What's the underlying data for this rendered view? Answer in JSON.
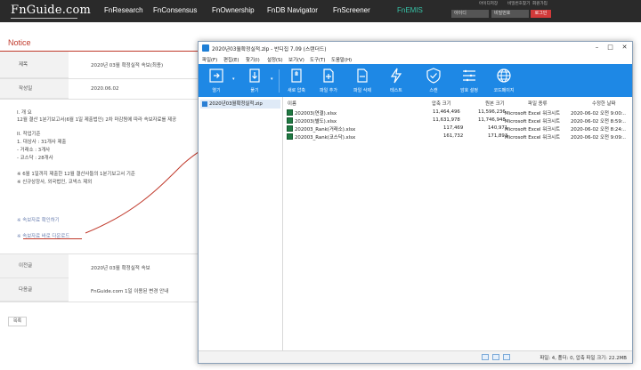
{
  "topbar": {
    "logo": "FnGuide.com",
    "nav": [
      "FnResearch",
      "FnConsensus",
      "FnOwnership",
      "FnDB Navigator",
      "FnScreener",
      "FnEMIS"
    ],
    "util_links": [
      "아이디저장",
      "비밀번호찾기",
      "회원가입"
    ],
    "id_placeholder": "아이디",
    "pw_placeholder": "비밀번호",
    "login_label": "로그인"
  },
  "notice": {
    "page_title": "Notice",
    "subject_label": "제목",
    "subject_value": "2020년 03월 확정실적 속보(최종)",
    "date_label": "작성일",
    "date_value": "2020.06.02",
    "body": [
      "I. 개 요",
      "12월 결산 1분기보고서(6월 1일 제출법인) 2차 마감됨에 따라 속보자료를 제공",
      "II. 작업기준",
      "1. 대상사 : 31개사 제출",
      "- 거래소 : 3개사",
      "- 코스닥 : 28개사",
      "※ 6월 1일까지 제출한 12월 결산사들의 1분기보고서 기준",
      "※ 신규상장사, 외국법인, 코넥스 제외"
    ],
    "link_check": "※ 속보자료 확인하기",
    "link_download": "※ 속보자료 바로 다운로드",
    "prev_label": "이전글",
    "prev_value": "2020년 03월 확정실적 속보",
    "next_label": "다음글",
    "next_value": "FnGuide.com 1일 이용된 변경 안내",
    "list_button": "목록"
  },
  "window": {
    "title": "2020년03월확정실적.zip - 반디집 7.09 (스탠더드)",
    "menu": [
      "파일(F)",
      "편집(E)",
      "찾기(I)",
      "설정(S)",
      "보기(V)",
      "도구(T)",
      "도움말(H)"
    ],
    "toolbar": [
      "열기",
      "풀기",
      "새로 압축",
      "파일 추가",
      "파일 삭제",
      "테스트",
      "스캔",
      "암호 설정",
      "코드페이지"
    ],
    "tree_root": "2020년03월확정실적.zip",
    "columns": [
      "이름",
      "압축 크기",
      "원본 크기",
      "파일 종류",
      "수정한 날짜"
    ],
    "files": [
      {
        "name": "202003(연결).xlsx",
        "packed": "11,464,496",
        "size": "11,596,236",
        "type": "Microsoft Excel 워크시트",
        "date": "2020-06-02 오전 9:00:.."
      },
      {
        "name": "202003(별도).xlsx",
        "packed": "11,631,978",
        "size": "11,746,948",
        "type": "Microsoft Excel 워크시트",
        "date": "2020-06-02 오전 8:59:.."
      },
      {
        "name": "202003_Rank(거래소).xlsx",
        "packed": "117,469",
        "size": "140,971",
        "type": "Microsoft Excel 워크시트",
        "date": "2020-06-02 오전 8:24:.."
      },
      {
        "name": "202003_Rank(코스닥).xlsx",
        "packed": "161,732",
        "size": "171,893",
        "type": "Microsoft Excel 워크시트",
        "date": "2020-06-02 오전 9:09:.."
      }
    ],
    "status": "파일: 4, 폴더: 0, 압축 파일 크기: 22.2MB"
  },
  "colors": {
    "topbar_bg": "#2a2a2a",
    "nav_active": "#38c4a8",
    "notice_red": "#c0392b",
    "toolbar_blue": "#1e88e5",
    "login_red": "#d23a3a"
  }
}
